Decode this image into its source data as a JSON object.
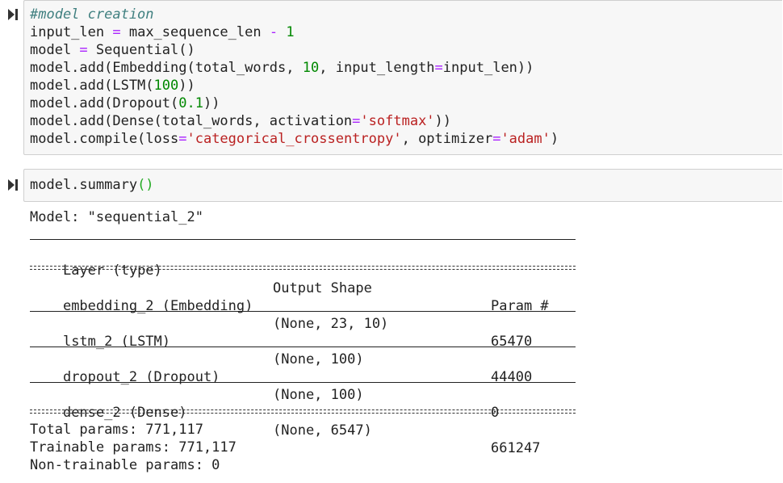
{
  "cell1": {
    "run_icon": "run-cell-icon",
    "lines": [
      [
        {
          "t": "#model creation",
          "k": "comment"
        }
      ],
      [
        {
          "t": "input_len ",
          "k": "plain"
        },
        {
          "t": "=",
          "k": "op"
        },
        {
          "t": " max_sequence_len ",
          "k": "plain"
        },
        {
          "t": "-",
          "k": "op"
        },
        {
          "t": " ",
          "k": "plain"
        },
        {
          "t": "1",
          "k": "num"
        }
      ],
      [
        {
          "t": "model ",
          "k": "plain"
        },
        {
          "t": "=",
          "k": "op"
        },
        {
          "t": " Sequential()",
          "k": "plain"
        }
      ],
      [
        {
          "t": "model.add(Embedding(total_words, ",
          "k": "plain"
        },
        {
          "t": "10",
          "k": "num"
        },
        {
          "t": ", input_length",
          "k": "plain"
        },
        {
          "t": "=",
          "k": "op"
        },
        {
          "t": "input_len))",
          "k": "plain"
        }
      ],
      [
        {
          "t": "model.add(LSTM(",
          "k": "plain"
        },
        {
          "t": "100",
          "k": "num"
        },
        {
          "t": "))",
          "k": "plain"
        }
      ],
      [
        {
          "t": "model.add(Dropout(",
          "k": "plain"
        },
        {
          "t": "0.1",
          "k": "num"
        },
        {
          "t": "))",
          "k": "plain"
        }
      ],
      [
        {
          "t": "model.add(Dense(total_words, activation",
          "k": "plain"
        },
        {
          "t": "=",
          "k": "op"
        },
        {
          "t": "'softmax'",
          "k": "str"
        },
        {
          "t": "))",
          "k": "plain"
        }
      ],
      [
        {
          "t": "model.compile(loss",
          "k": "plain"
        },
        {
          "t": "=",
          "k": "op"
        },
        {
          "t": "'categorical_crossentropy'",
          "k": "str"
        },
        {
          "t": ", optimizer",
          "k": "plain"
        },
        {
          "t": "=",
          "k": "op"
        },
        {
          "t": "'adam'",
          "k": "str"
        },
        {
          "t": ")",
          "k": "plain"
        }
      ]
    ]
  },
  "cell2": {
    "run_icon": "run-cell-icon",
    "code_prefix": "model.summary",
    "code_parens": "()"
  },
  "summary": {
    "model_line": "Model: \"sequential_2\"",
    "header": {
      "layer": "Layer (type)",
      "shape": "Output Shape",
      "params": "Param #"
    },
    "rows": [
      {
        "layer": "embedding_2 (Embedding)",
        "shape": "(None, 23, 10)",
        "params": "65470"
      },
      {
        "layer": "lstm_2 (LSTM)",
        "shape": "(None, 100)",
        "params": "44400"
      },
      {
        "layer": "dropout_2 (Dropout)",
        "shape": "(None, 100)",
        "params": "0"
      },
      {
        "layer": "dense_2 (Dense)",
        "shape": "(None, 6547)",
        "params": "661247"
      }
    ],
    "total": "Total params: 771,117",
    "trainable": "Trainable params: 771,117",
    "non_trainable": "Non-trainable params: 0"
  }
}
